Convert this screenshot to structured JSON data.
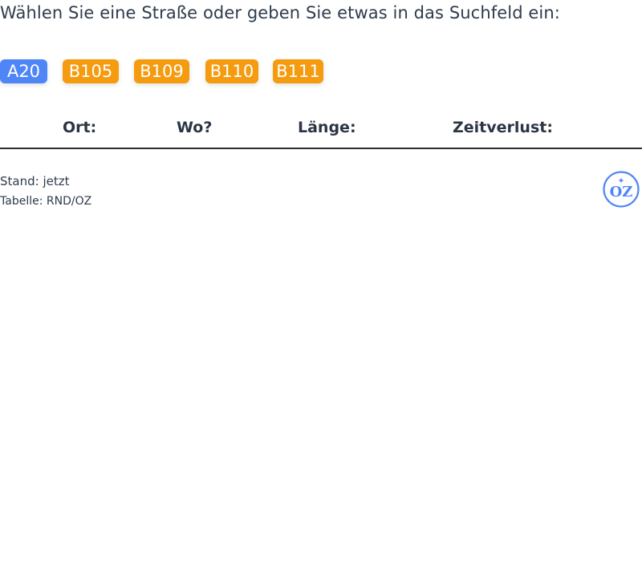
{
  "prompt": "Wählen Sie eine Straße oder geben Sie etwas in das Suchfeld ein:",
  "road_chips": [
    {
      "label": "A20",
      "state": "selected",
      "color": "#4f86f7"
    },
    {
      "label": "B105",
      "state": "unselected",
      "color": "#f49b10"
    },
    {
      "label": "B109",
      "state": "unselected",
      "color": "#f49b10"
    },
    {
      "label": "B110",
      "state": "unselected",
      "color": "#f49b10"
    },
    {
      "label": "B111",
      "state": "unselected",
      "color": "#f49b10"
    }
  ],
  "table": {
    "columns": [
      "Ort:",
      "Wo?",
      "Länge:",
      "Zeitverlust:"
    ],
    "rows": []
  },
  "footer": {
    "status": "Stand: jetzt",
    "source": "Tabelle: RND/OZ"
  },
  "logo": {
    "text": "OZ",
    "icon": "oz-logo-icon",
    "color": "#4f86f7"
  }
}
